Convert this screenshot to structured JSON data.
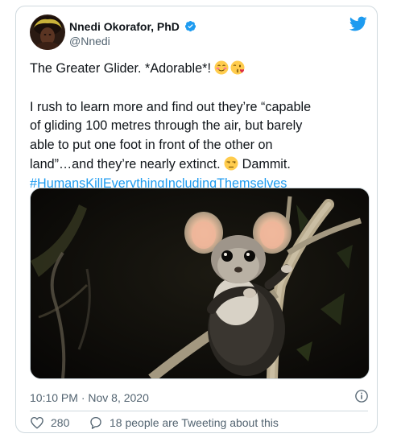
{
  "author": {
    "name": "Nnedi Okorafor, PhD",
    "handle": "@Nnedi"
  },
  "tweet": {
    "line1": "The Greater Glider. *Adorable*!",
    "line2": "I rush to learn more and find out they’re “capable",
    "line3": "of gliding 100 metres through the air, but barely",
    "line4": "able to put one foot in front of the other on",
    "line5a": "land”…and they’re nearly extinct.",
    "line5b": "Dammit.",
    "hashtag": "#HumansKillEverythingIncludingThemselves"
  },
  "meta": {
    "timestamp": "10:10 PM · Nov 8, 2020",
    "likes": "280",
    "tweeting": "18 people are Tweeting about this"
  },
  "icons": {
    "verified": "verified-badge-icon",
    "platform": "twitter-bird-icon",
    "info": "info-icon",
    "like": "heart-icon",
    "reply": "speech-bubble-icon"
  },
  "colors": {
    "accent": "#1d9bf0",
    "text": "#0f1419",
    "muted": "#536471",
    "border": "#cfd9de"
  }
}
